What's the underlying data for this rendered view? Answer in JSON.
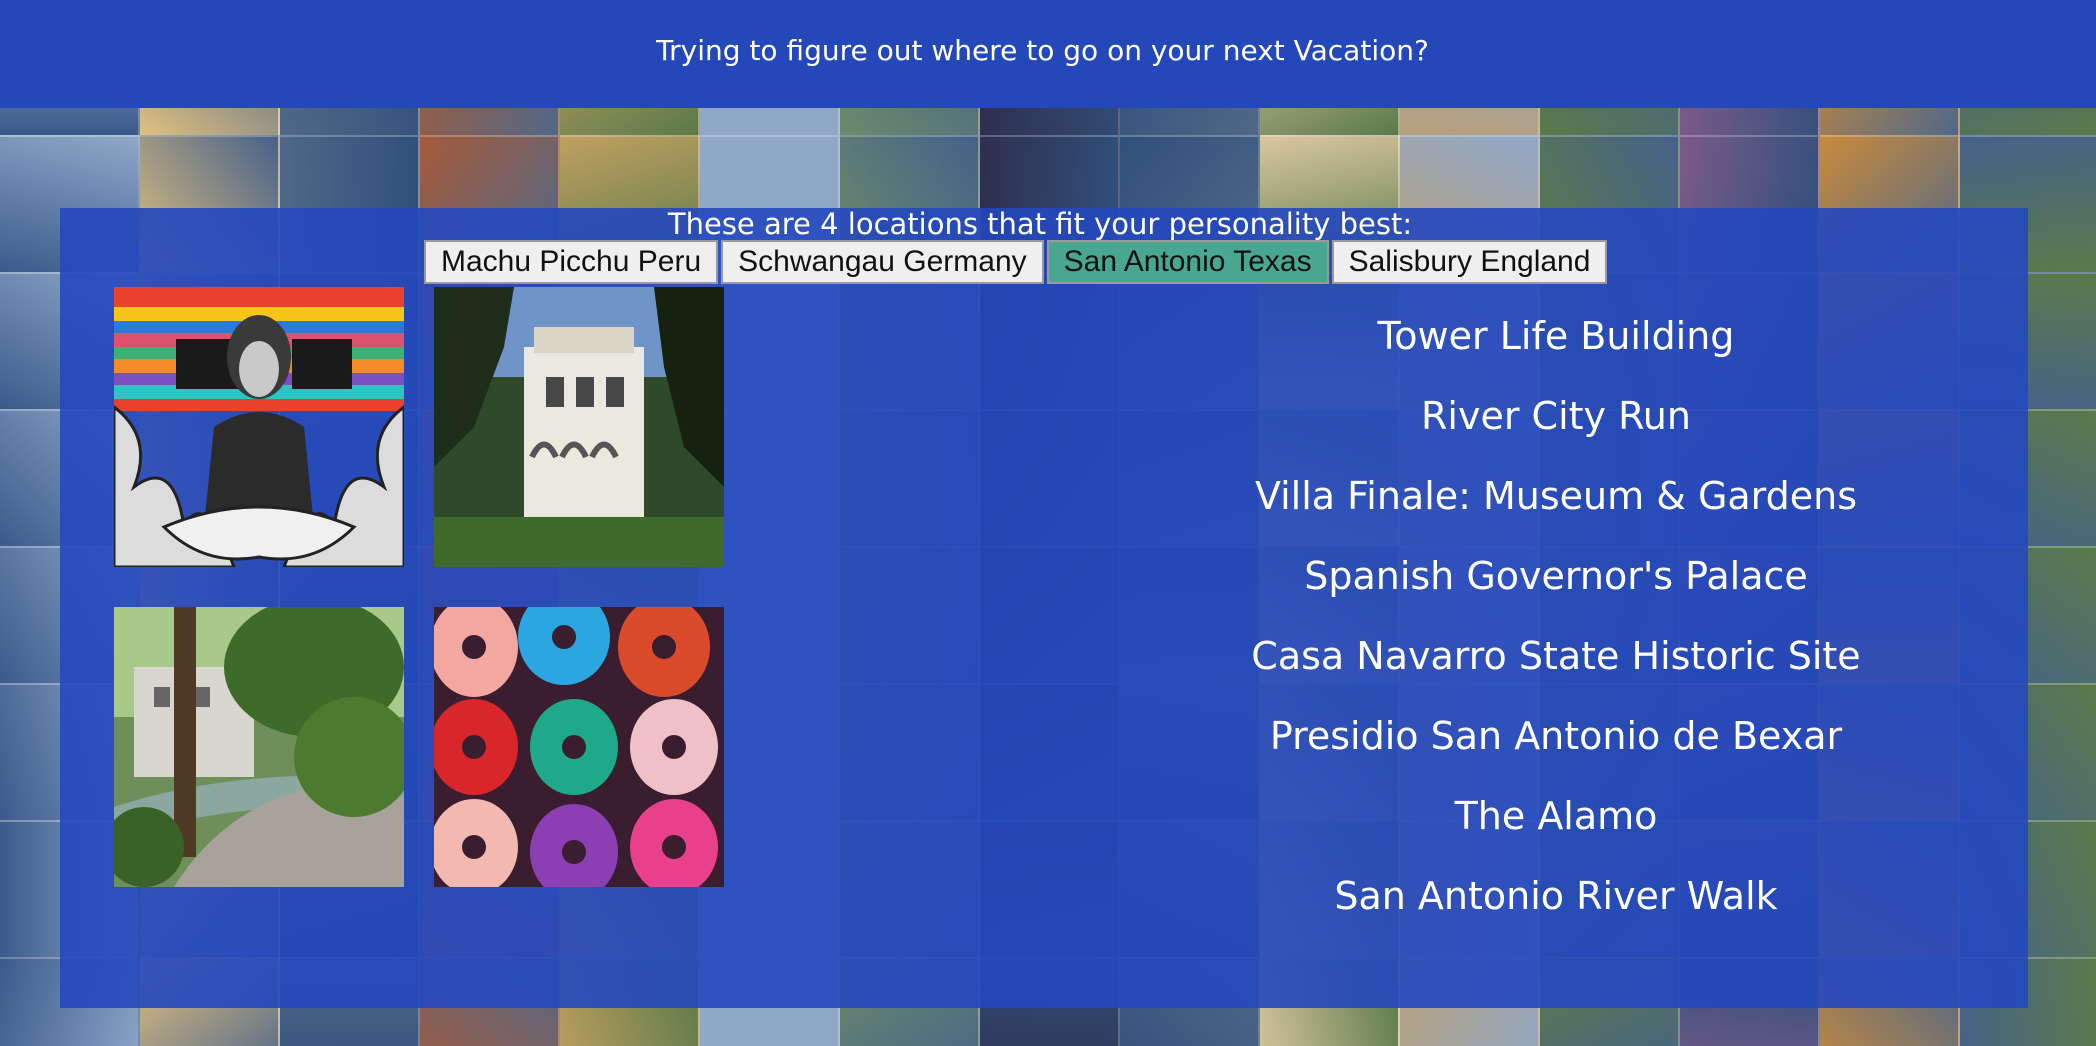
{
  "header": {
    "title": "Trying to figure out where to go on your next Vacation?"
  },
  "panel": {
    "subtitle": "These are 4 locations that fit your personality best:"
  },
  "tabs": [
    {
      "label": "Machu Picchu Peru",
      "active": false
    },
    {
      "label": "Schwangau Germany",
      "active": false
    },
    {
      "label": "San Antonio Texas",
      "active": true
    },
    {
      "label": "Salisbury England",
      "active": false
    }
  ],
  "photos": [
    {
      "icon": "mural-photo"
    },
    {
      "icon": "villa-photo"
    },
    {
      "icon": "riverwalk-photo"
    },
    {
      "icon": "guitars-photo"
    }
  ],
  "places": [
    "Tower Life Building",
    "River City Run",
    "Villa Finale: Museum & Gardens",
    "Spanish Governor's Palace",
    "Casa Navarro State Historic Site",
    "Presidio San Antonio de Bexar",
    "The Alamo",
    "San Antonio River Walk"
  ],
  "colors": {
    "header_bg": "#2447b9",
    "panel_bg": "#2448be",
    "active_tab": "#4aa78f",
    "tab_bg": "#efefef"
  }
}
